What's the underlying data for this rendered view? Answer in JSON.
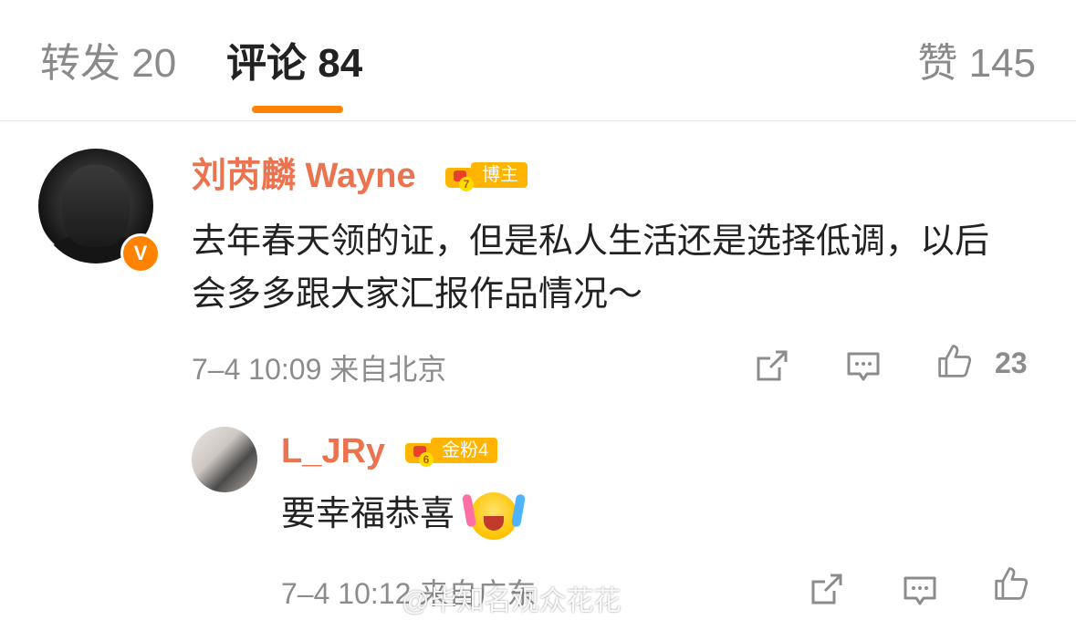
{
  "tabs": {
    "repost": "转发 20",
    "comments": "评论 84",
    "likes": "赞 145"
  },
  "colors": {
    "accent": "#ff8200",
    "username": "#eb7350",
    "badge": "#ffb400",
    "meta": "#8c8c8c"
  },
  "comment": {
    "username": "刘芮麟 Wayne",
    "badge_label": "博主",
    "badge_level": "7",
    "verified_mark": "V",
    "text": "去年春天领的证，但是私人生活还是选择低调，以后会多多跟大家汇报作品情况～",
    "meta": "7–4 10:09  来自北京",
    "like_count": "23",
    "icons": [
      "share-icon",
      "comment-icon",
      "like-icon"
    ]
  },
  "reply": {
    "username": "L_JRy",
    "badge_label": "金粉4",
    "badge_level": "6",
    "text": "要幸福恭喜",
    "emoji": "celebrate-emoji",
    "meta": "7–4 10:12  来自广东",
    "icons": [
      "share-icon",
      "comment-icon",
      "like-icon"
    ]
  },
  "watermark": "@毕知名观众花花"
}
